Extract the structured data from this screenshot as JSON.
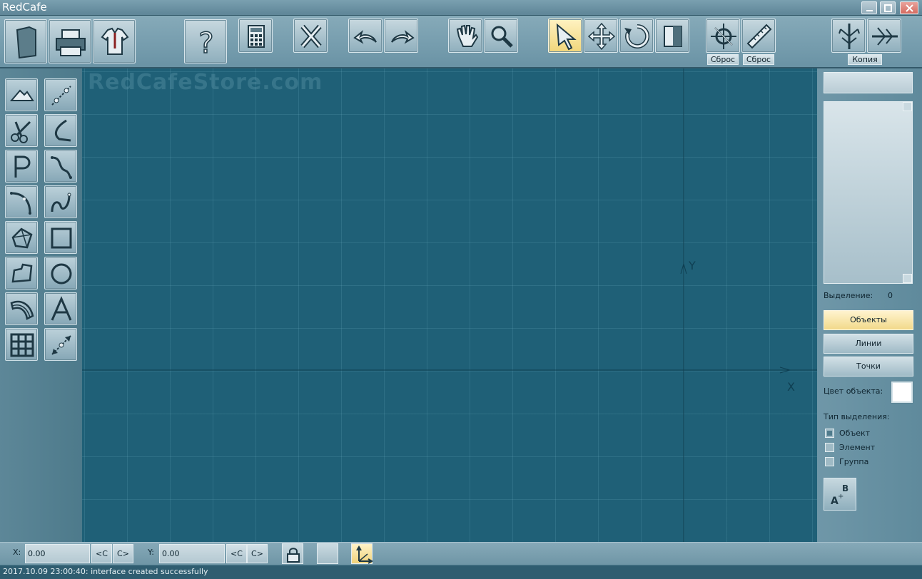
{
  "app": {
    "title": "RedCafe"
  },
  "toolbar": {
    "reset_label_1": "Сброс",
    "reset_label_2": "Сброс",
    "copy_label": "Копия",
    "icons": [
      "new-document",
      "print",
      "garment",
      "help",
      "calculator",
      "delete",
      "undo",
      "redo",
      "pan-hand",
      "zoom",
      "select-arrow",
      "move",
      "rotate",
      "mirror",
      "snap-reset",
      "ruler",
      "mirror-vertical",
      "mirror-horizontal"
    ]
  },
  "canvas": {
    "watermark": "RedCafeStore.com",
    "axis_x_label": "X",
    "axis_y_label": "Y"
  },
  "right_panel": {
    "selection_label": "Выделение:",
    "selection_count": "0",
    "btn_objects": "Объекты",
    "btn_lines": "Линии",
    "btn_points": "Точки",
    "object_color_label": "Цвет объекта:",
    "object_color": "#ffffff",
    "selection_type_label": "Тип выделения:",
    "opt_object": "Объект",
    "opt_element": "Элемент",
    "opt_group": "Группа"
  },
  "coords": {
    "x_label": "X:",
    "x_value": "0.00",
    "y_label": "Y:",
    "y_value": "0.00",
    "btn_prev": "<C",
    "btn_next": "C>"
  },
  "log": {
    "message": "2017.10.09 23:00:40: interface created successfully"
  }
}
